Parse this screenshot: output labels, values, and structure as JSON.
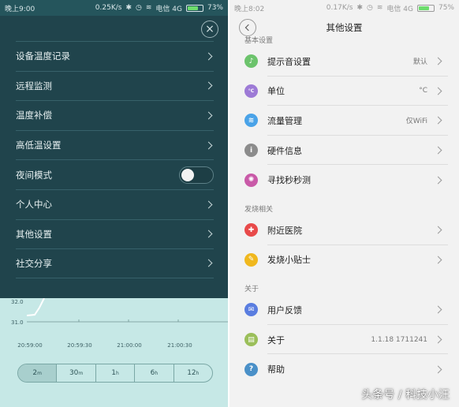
{
  "left": {
    "status_bar": {
      "time": "晚上9:00",
      "speed": "0.25K/s",
      "carrier": "电信 4G",
      "battery": "73%",
      "battery_level": 0.73
    },
    "close_symbol": "×",
    "menu": [
      {
        "label": "设备温度记录"
      },
      {
        "label": "远程监测"
      },
      {
        "label": "温度补偿"
      },
      {
        "label": "高低温设置"
      },
      {
        "label": "夜间模式",
        "toggle": false
      },
      {
        "label": "个人中心"
      },
      {
        "label": "其他设置"
      },
      {
        "label": "社交分享"
      }
    ],
    "chart_data": {
      "type": "line",
      "y_ticks": [
        "32.0",
        "31.0"
      ],
      "x_ticks": [
        "20:59:00",
        "20:59:30",
        "21:00:00",
        "21:00:30"
      ],
      "series_color": "#ffffff"
    },
    "range_buttons": [
      {
        "value": "2",
        "unit": "m"
      },
      {
        "value": "30",
        "unit": "m"
      },
      {
        "value": "1",
        "unit": "h"
      },
      {
        "value": "6",
        "unit": "h"
      },
      {
        "value": "12",
        "unit": "h"
      }
    ]
  },
  "right": {
    "status_bar": {
      "time": "晚上8:02",
      "speed": "0.17K/s",
      "carrier": "电信 4G",
      "battery": "75%",
      "battery_level": 0.75
    },
    "title": "其他设置",
    "sections": [
      {
        "label": "基本设置",
        "rows": [
          {
            "label": "提示音设置",
            "value": "默认",
            "icon": "bell-icon",
            "glyph": "♪",
            "color": "#6cc36c"
          },
          {
            "label": "单位",
            "value": "°C",
            "icon": "unit-icon",
            "glyph": "°C",
            "color": "#9d7ad6"
          },
          {
            "label": "流量管理",
            "value": "仅WiFi",
            "icon": "wifi-icon",
            "glyph": "≋",
            "color": "#4aa3e8"
          },
          {
            "label": "硬件信息",
            "value": "",
            "icon": "info-icon",
            "glyph": "i",
            "color": "#8c8c8c"
          },
          {
            "label": "寻找秒秒测",
            "value": "",
            "icon": "find-device-icon",
            "glyph": "✺",
            "color": "#c95aa8"
          }
        ]
      },
      {
        "label": "发烧相关",
        "rows": [
          {
            "label": "附近医院",
            "value": "",
            "icon": "hospital-icon",
            "glyph": "✚",
            "color": "#e84a4a"
          },
          {
            "label": "发烧小贴士",
            "value": "",
            "icon": "tips-icon",
            "glyph": "✎",
            "color": "#f0b81e"
          }
        ]
      },
      {
        "label": "关于",
        "rows": [
          {
            "label": "用户反馈",
            "value": "",
            "icon": "feedback-icon",
            "glyph": "✉",
            "color": "#5a7de0"
          },
          {
            "label": "关于",
            "value": "1.1.18 1711241",
            "icon": "about-icon",
            "glyph": "▤",
            "color": "#9bbf5a"
          },
          {
            "label": "帮助",
            "value": "",
            "icon": "help-icon",
            "glyph": "?",
            "color": "#4a90c8"
          }
        ]
      }
    ]
  },
  "watermark": "头条号 / 科技小汪"
}
